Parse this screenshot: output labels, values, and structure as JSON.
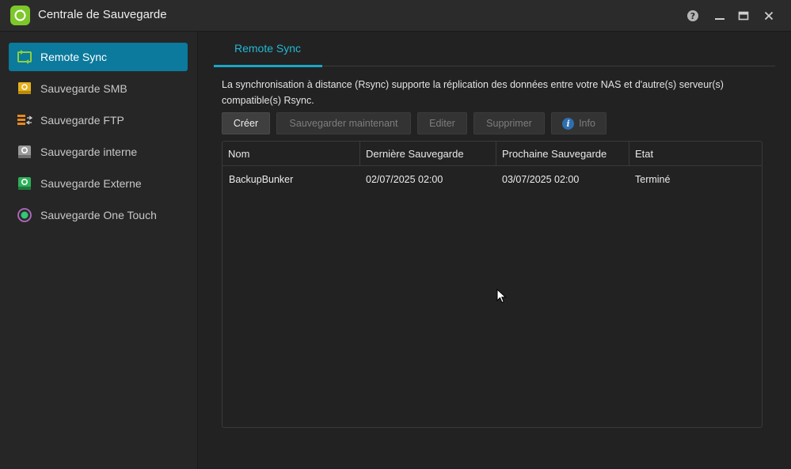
{
  "app": {
    "title": "Centrale de Sauvegarde",
    "icon": "refresh-icon",
    "accent": "#7dc72a"
  },
  "window_controls": {
    "help": "help-icon",
    "minimize": "minimize-icon",
    "maximize": "maximize-icon",
    "close": "close-icon"
  },
  "sidebar": {
    "items": [
      {
        "label": "Remote Sync",
        "icon": "remote-sync-icon",
        "active": true
      },
      {
        "label": "Sauvegarde SMB",
        "icon": "smb-icon"
      },
      {
        "label": "Sauvegarde FTP",
        "icon": "ftp-icon"
      },
      {
        "label": "Sauvegarde interne",
        "icon": "internal-backup-icon"
      },
      {
        "label": "Sauvegarde Externe",
        "icon": "external-backup-icon"
      },
      {
        "label": "Sauvegarde One Touch",
        "icon": "one-touch-icon"
      }
    ],
    "active_color": "#0b7a9c"
  },
  "main": {
    "tabs": [
      {
        "label": "Remote Sync",
        "active": true
      }
    ],
    "description": "La synchronisation à distance (Rsync) supporte la réplication des données entre votre NAS et d'autre(s) serveur(s) compatible(s) Rsync.",
    "toolbar": {
      "create_label": "Créer",
      "backup_now_label": "Sauvegarder maintenant",
      "edit_label": "Editer",
      "delete_label": "Supprimer",
      "info_label": "Info",
      "info_icon": "i"
    },
    "table": {
      "columns": [
        "Nom",
        "Dernière Sauvegarde",
        "Prochaine Sauvegarde",
        "Etat"
      ],
      "rows": [
        {
          "name": "BackupBunker",
          "last": "02/07/2025 02:00",
          "next": "03/07/2025 02:00",
          "status": "Terminé"
        }
      ]
    }
  }
}
